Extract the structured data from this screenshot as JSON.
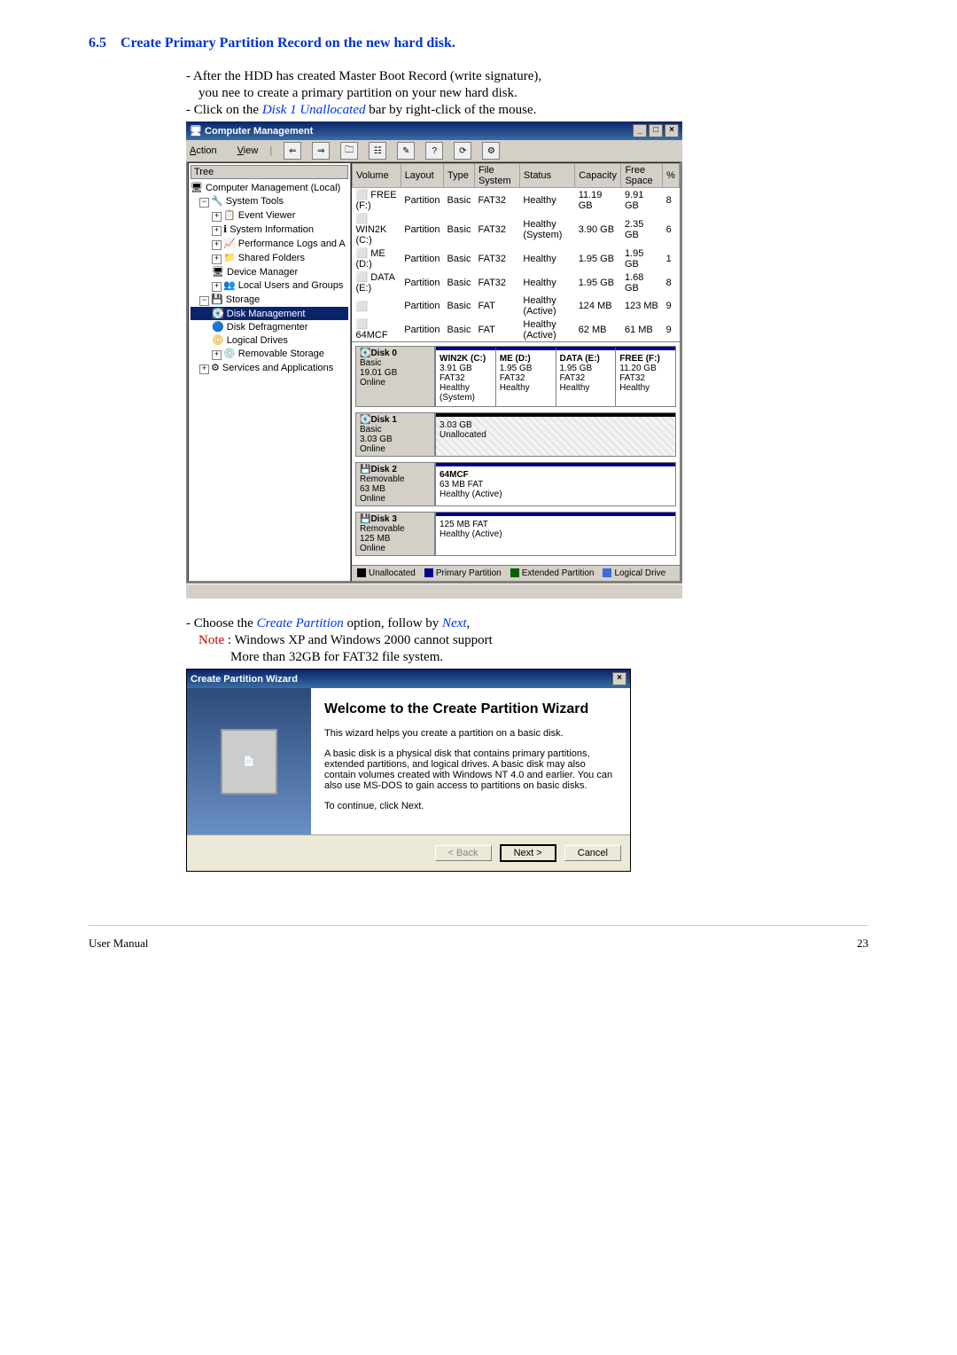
{
  "section": {
    "number": "6.5",
    "title": "Create Primary Partition Record on the new hard disk."
  },
  "bullets": {
    "b1": "- After the HDD has created Master Boot Record (write signature),",
    "b1b": "you nee to create a primary partition on your new hard disk.",
    "b2a": "- Click on the ",
    "b2b": "Disk 1 Unallocated",
    "b2c": " bar by right-click of the mouse."
  },
  "cm": {
    "title": "Computer Management",
    "menu": {
      "action": "Action",
      "view": "View"
    },
    "tree_tab": "Tree",
    "tree": {
      "root": "Computer Management (Local)",
      "systools": "System Tools",
      "event": "Event Viewer",
      "sysinfo": "System Information",
      "perf": "Performance Logs and A",
      "shared": "Shared Folders",
      "devmgr": "Device Manager",
      "users": "Local Users and Groups",
      "storage": "Storage",
      "diskmgmt": "Disk Management",
      "defrag": "Disk Defragmenter",
      "logical": "Logical Drives",
      "removable": "Removable Storage",
      "services": "Services and Applications"
    },
    "cols": {
      "volume": "Volume",
      "layout": "Layout",
      "type": "Type",
      "fs": "File System",
      "status": "Status",
      "capacity": "Capacity",
      "free": "Free Space",
      "pct": "%"
    },
    "volumes": [
      {
        "v": "FREE (F:)",
        "l": "Partition",
        "t": "Basic",
        "fs": "FAT32",
        "s": "Healthy",
        "c": "11.19 GB",
        "f": "9.91 GB",
        "p": "8"
      },
      {
        "v": "WIN2K (C:)",
        "l": "Partition",
        "t": "Basic",
        "fs": "FAT32",
        "s": "Healthy (System)",
        "c": "3.90 GB",
        "f": "2.35 GB",
        "p": "6"
      },
      {
        "v": "ME (D:)",
        "l": "Partition",
        "t": "Basic",
        "fs": "FAT32",
        "s": "Healthy",
        "c": "1.95 GB",
        "f": "1.95 GB",
        "p": "1"
      },
      {
        "v": "DATA (E:)",
        "l": "Partition",
        "t": "Basic",
        "fs": "FAT32",
        "s": "Healthy",
        "c": "1.95 GB",
        "f": "1.68 GB",
        "p": "8"
      },
      {
        "v": "",
        "l": "Partition",
        "t": "Basic",
        "fs": "FAT",
        "s": "Healthy (Active)",
        "c": "124 MB",
        "f": "123 MB",
        "p": "9"
      },
      {
        "v": "64MCF",
        "l": "Partition",
        "t": "Basic",
        "fs": "FAT",
        "s": "Healthy (Active)",
        "c": "62 MB",
        "f": "61 MB",
        "p": "9"
      }
    ],
    "disks": {
      "d0": {
        "name": "Disk 0",
        "type": "Basic",
        "size": "19.01 GB",
        "state": "Online",
        "parts": [
          {
            "n": "WIN2K (C:)",
            "d": "3.91 GB FAT32",
            "s": "Healthy (System)"
          },
          {
            "n": "ME (D:)",
            "d": "1.95 GB FAT32",
            "s": "Healthy"
          },
          {
            "n": "DATA (E:)",
            "d": "1.95 GB FAT32",
            "s": "Healthy"
          },
          {
            "n": "FREE (F:)",
            "d": "11.20 GB FAT32",
            "s": "Healthy"
          }
        ]
      },
      "d1": {
        "name": "Disk 1",
        "type": "Basic",
        "size": "3.03 GB",
        "state": "Online",
        "parts": [
          {
            "n": "",
            "d": "3.03 GB",
            "s": "Unallocated"
          }
        ]
      },
      "d2": {
        "name": "Disk 2",
        "type": "Removable",
        "size": "63 MB",
        "state": "Online",
        "parts": [
          {
            "n": "64MCF",
            "d": "63 MB FAT",
            "s": "Healthy (Active)"
          }
        ]
      },
      "d3": {
        "name": "Disk 3",
        "type": "Removable",
        "size": "125 MB",
        "state": "Online",
        "parts": [
          {
            "n": "",
            "d": "125 MB FAT",
            "s": "Healthy (Active)"
          }
        ]
      }
    },
    "legend": {
      "unalloc": "Unallocated",
      "primary": "Primary Partition",
      "extended": "Extended Partition",
      "logical": "Logical Drive"
    }
  },
  "mid": {
    "l1a": "- Choose the ",
    "l1b": "Create Partition",
    "l1c": " option, follow by ",
    "l1d": "Next",
    "l1e": ",",
    "l2a": "Note",
    "l2b": " : Windows XP and Windows 2000 cannot support",
    "l3": "More than 32GB for FAT32 file system."
  },
  "wizard": {
    "title": "Create Partition Wizard",
    "heading": "Welcome to the Create Partition Wizard",
    "p1": "This wizard helps you create a partition on a basic disk.",
    "p2": "A basic disk is a physical disk that contains primary partitions, extended partitions, and logical drives. A basic disk may also contain volumes created with Windows NT 4.0 and earlier. You can also use MS-DOS to gain access to partitions on basic disks.",
    "p3": "To continue, click Next.",
    "back": "< Back",
    "next": "Next >",
    "cancel": "Cancel"
  },
  "footer": {
    "left": "User Manual",
    "right": "23"
  }
}
